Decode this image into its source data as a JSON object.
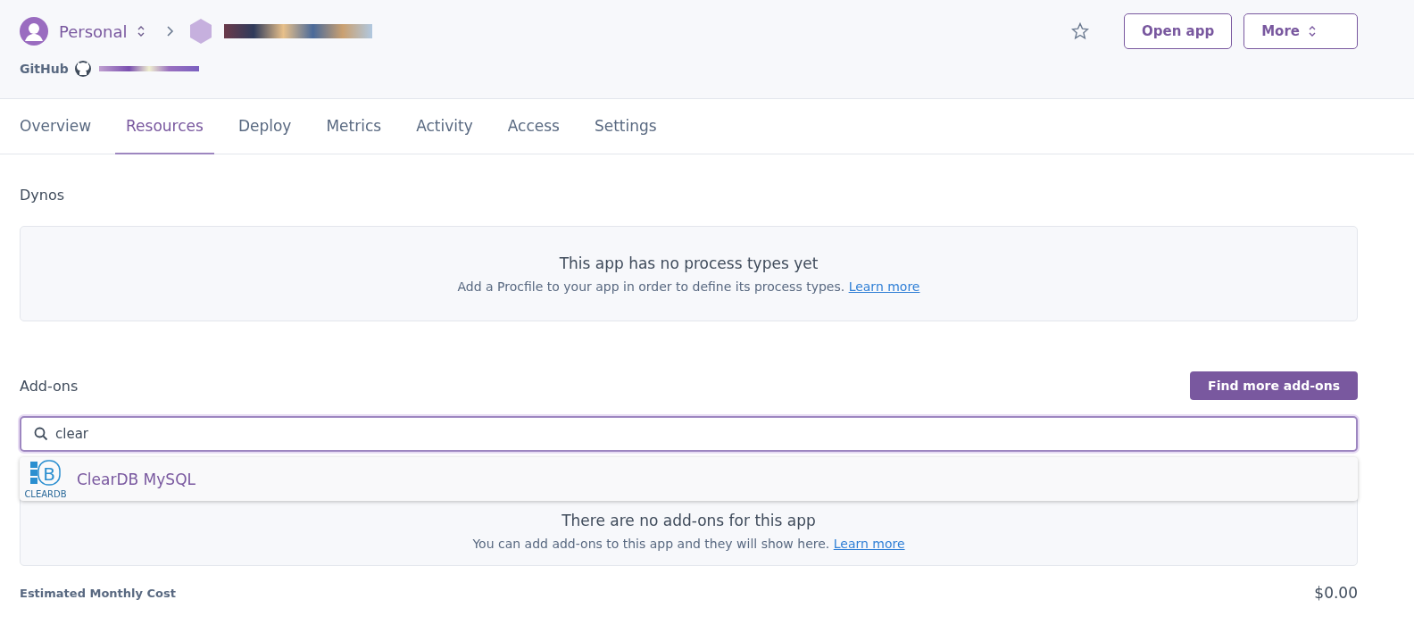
{
  "header": {
    "team": "Personal",
    "source_label": "GitHub",
    "actions": [
      {
        "kind": "open",
        "label": "Open app"
      },
      {
        "kind": "more",
        "label": "More"
      }
    ]
  },
  "tabs": [
    {
      "label": "Overview",
      "selected": false
    },
    {
      "label": "Resources",
      "selected": true
    },
    {
      "label": "Deploy",
      "selected": false
    },
    {
      "label": "Metrics",
      "selected": false
    },
    {
      "label": "Activity",
      "selected": false
    },
    {
      "label": "Access",
      "selected": false
    },
    {
      "label": "Settings",
      "selected": false
    }
  ],
  "dynos": {
    "title": "Dynos",
    "empty_title": "This app has no process types yet",
    "empty_text": "Add a Procfile to your app in order to define its process types.",
    "link": "Learn more"
  },
  "addons": {
    "title": "Add-ons",
    "button": "Find more add-ons",
    "search": {
      "value": "clear"
    },
    "results": [
      {
        "name": "ClearDB MySQL",
        "logo_letter": "B",
        "logo_caption": "CLEARDB"
      }
    ],
    "empty_title": "There are no add-ons for this app",
    "empty_text": "You can add add-ons to this app and they will show here.",
    "link": "Learn more"
  },
  "cost": {
    "label": "Estimated Monthly Cost",
    "value": "$0.00"
  }
}
